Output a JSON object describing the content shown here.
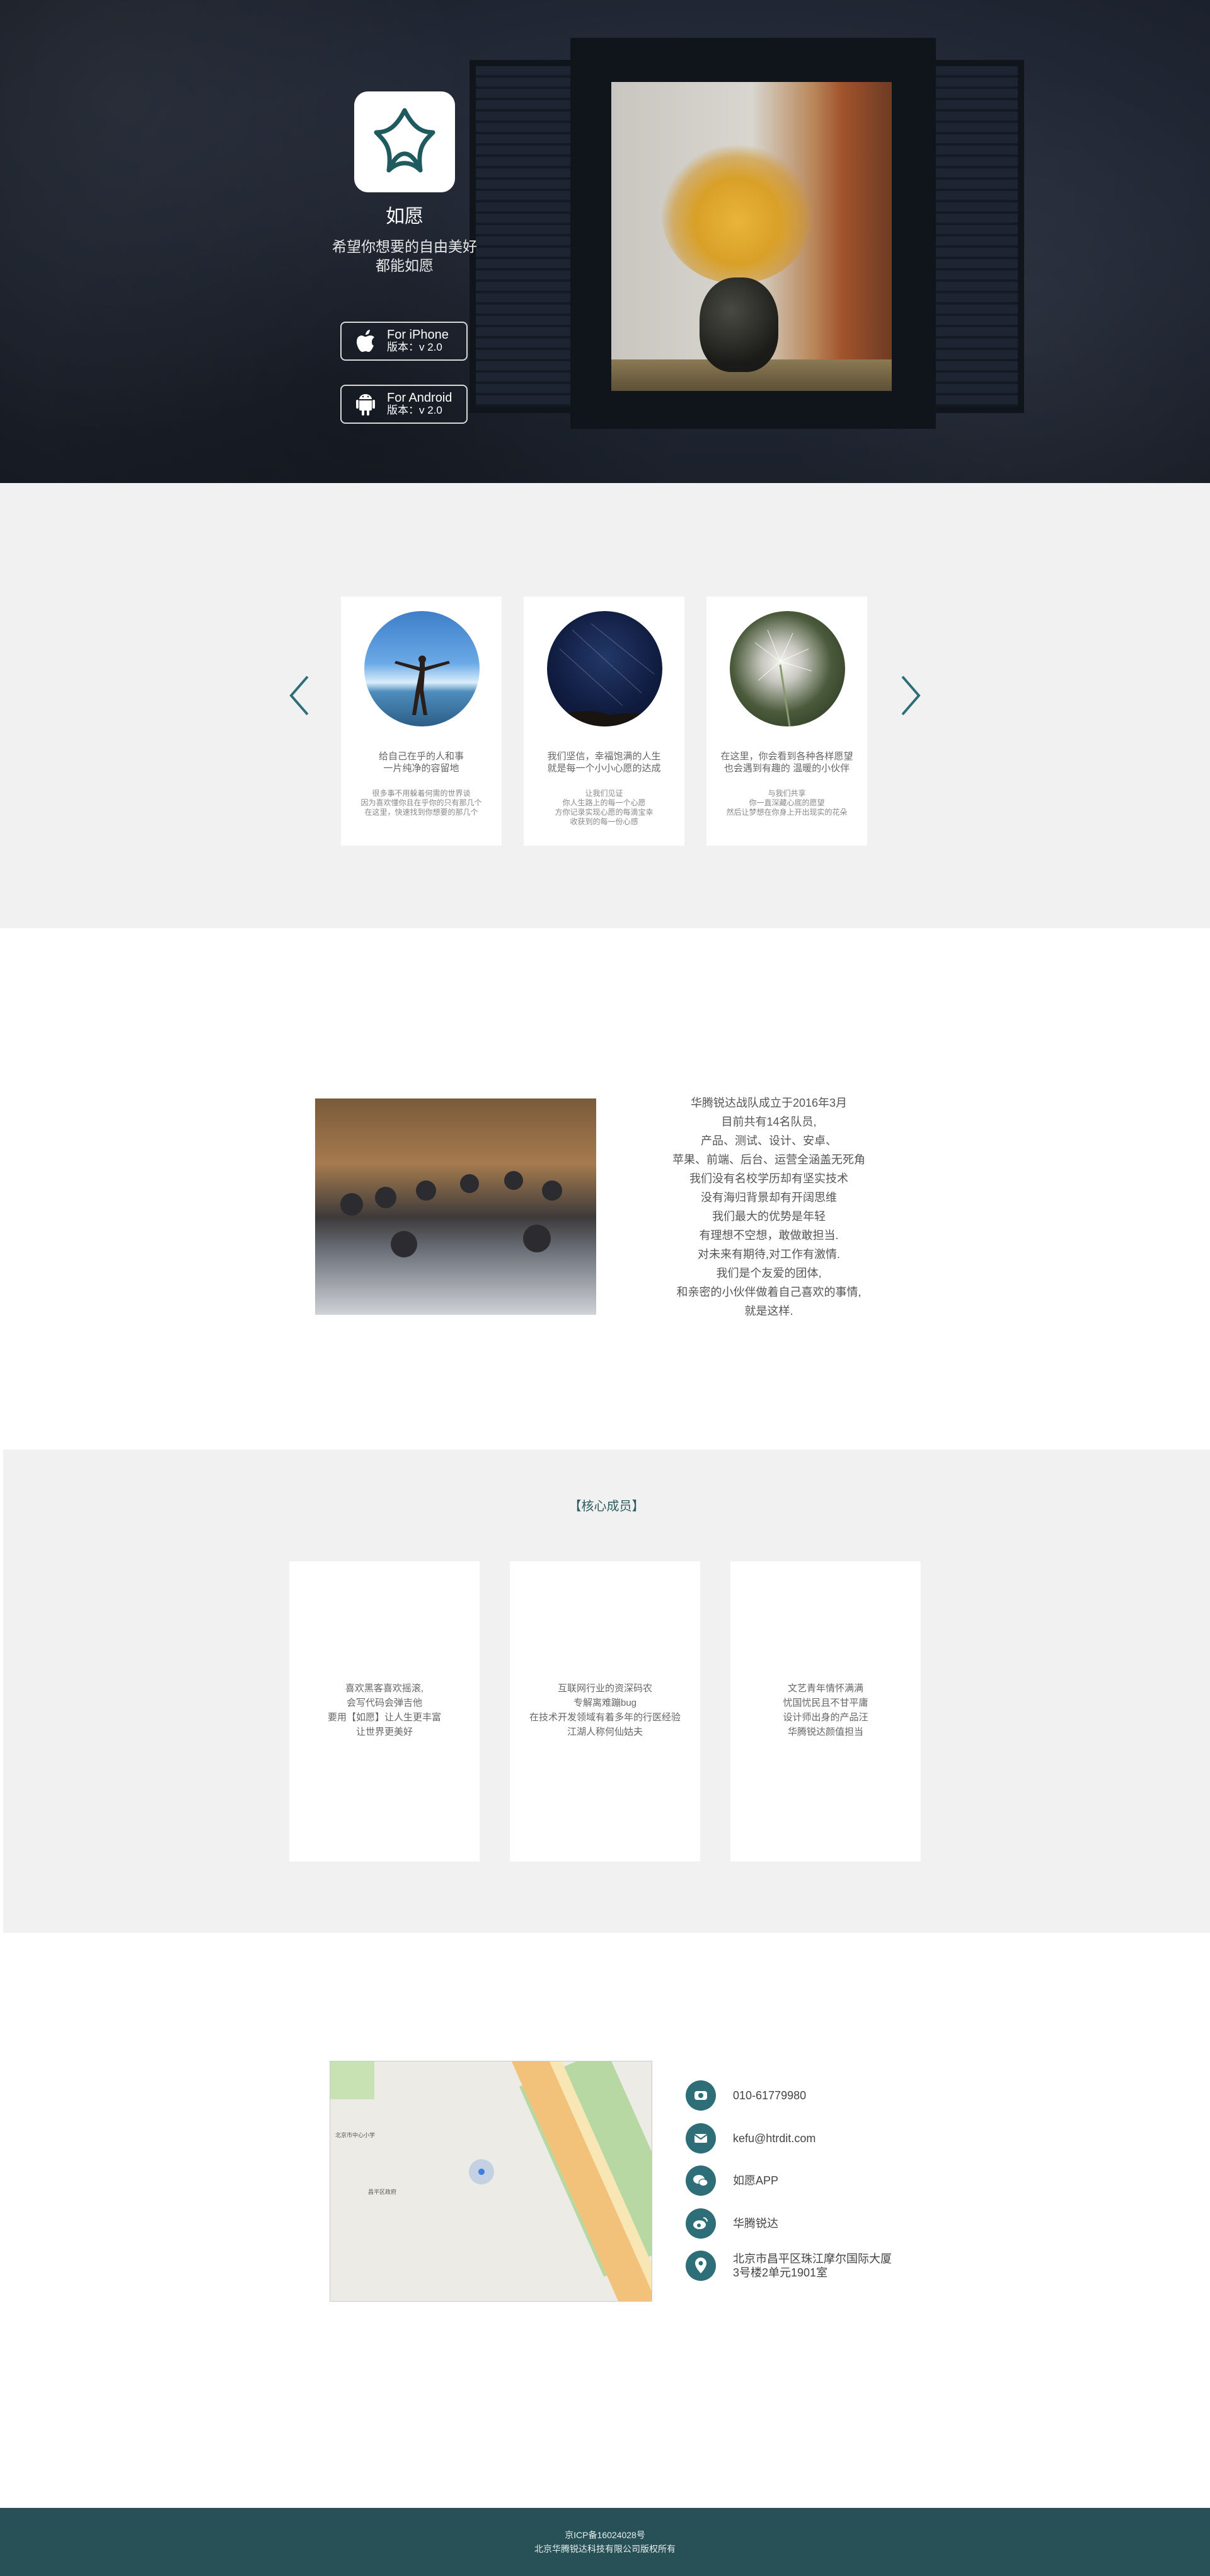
{
  "hero": {
    "app_name": "如愿",
    "slogan_line1": "希望你想要的自由美好",
    "slogan_line2": "都能如愿",
    "iphone": {
      "label": "For iPhone",
      "version": "版本：v 2.0",
      "icon": "apple-icon"
    },
    "android": {
      "label": "For Android",
      "version": "版本：v 2.0",
      "icon": "android-icon"
    }
  },
  "carousel": {
    "prev_icon": "chevron-left-icon",
    "next_icon": "chevron-right-icon",
    "cards": [
      {
        "caption_line1": "给自己在乎的人和事",
        "caption_line2": "一片纯净的容留地",
        "detail_line1": "很多事不用躲着何需的世界谈",
        "detail_line2": "因为喜欢懂你且在乎你的只有那几个",
        "detail_line3": "在这里，快速找到你想要的那几个"
      },
      {
        "caption_line1": "我们坚信，幸福饱满的人生",
        "caption_line2": "就是每一个小小心愿的达成",
        "detail_line1": "让我们见证",
        "detail_line2": "你人生路上的每一个心愿",
        "detail_line3": "方你记录实现心愿的每滴宝幸",
        "detail_line4": "收获到的每一份心感"
      },
      {
        "caption_line1": "在这里，你会看到各种各样愿望",
        "caption_line2": "也会遇到有趣的 温暖的小伙伴",
        "detail_line1": "与我们共享",
        "detail_line2": "你一直深藏心底的愿望",
        "detail_line3": "然后让梦想在你身上开出现实的花朵"
      }
    ]
  },
  "team": {
    "lines": [
      "华腾锐达战队成立于2016年3月",
      "目前共有14名队员,",
      "产品、测试、设计、安卓、",
      "苹果、前端、后台、运营全涵盖无死角",
      "我们没有名校学历却有坚实技术",
      "没有海归背景却有开阔思维",
      "我们最大的优势是年轻",
      "有理想不空想，敢做敢担当.",
      "对未来有期待,对工作有激情.",
      "我们是个友爱的团体,",
      "和亲密的小伙伴做着自己喜欢的事情,",
      "就是这样."
    ]
  },
  "core": {
    "title": "【核心成员】",
    "members": [
      {
        "line1": "喜欢黑客喜欢摇滚,",
        "line2": "会写代码会弹吉他",
        "line3": "要用【如愿】让人生更丰富",
        "line4": "让世界更美好"
      },
      {
        "line1": "互联网行业的资深码农",
        "line2": "专解离难蹦bug",
        "line3": "在技术开发领域有着多年的行医经验",
        "line4": "江湖人称何仙姑夫"
      },
      {
        "line1": "文艺青年情怀满满",
        "line2": "忧国忧民且不甘平庸",
        "line3": "设计师出身的产品汪",
        "line4": "华腾锐达颜值担当"
      }
    ]
  },
  "contact": {
    "phone": "010-61779980",
    "email": "kefu@htrdit.com",
    "wechat": "如愿APP",
    "weibo": "华腾锐达",
    "address_line1": "北京市昌平区珠江摩尔国际大厦",
    "address_line2": "3号楼2单元1901室",
    "icons": [
      "phone-icon",
      "mail-icon",
      "wechat-icon",
      "weibo-icon",
      "location-icon"
    ],
    "map_labels": [
      "北京市中心小学",
      "昌平区政府"
    ]
  },
  "footer": {
    "icp": "京ICP备16024028号",
    "copyright": "北京华腾锐达科技有限公司版权所有"
  },
  "colors": {
    "accent": "#2e6e78",
    "footer_bg": "#285157",
    "section_gray": "#f1f1f1"
  }
}
